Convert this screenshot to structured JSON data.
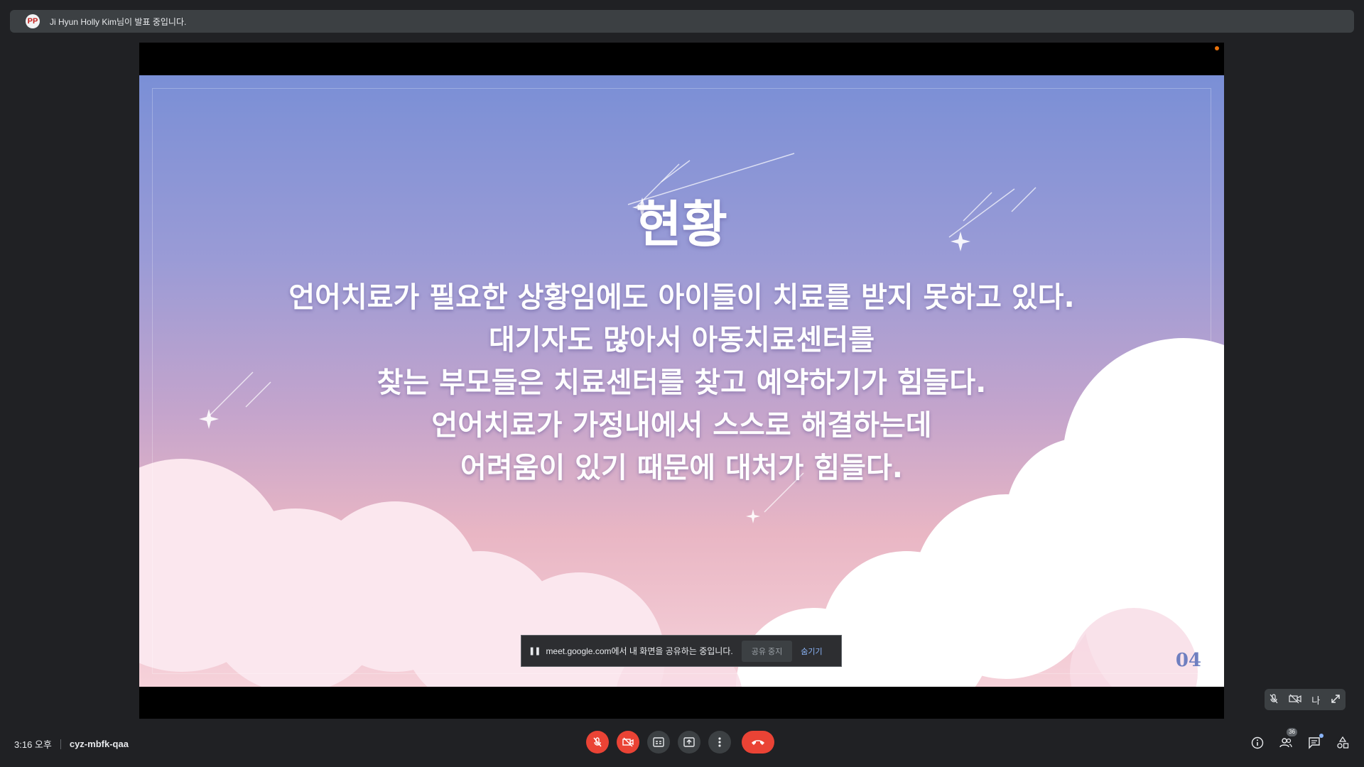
{
  "presenter_bar": {
    "avatar_text": "PP",
    "text": "Ji Hyun Holly Kim님이 발표 중입니다."
  },
  "slide": {
    "title": "현황",
    "body_lines": [
      "언어치료가 필요한 상황임에도 아이들이 치료를 받지 못하고 있다.",
      "대기자도 많아서 아동치료센터를",
      "찾는 부모들은 치료센터를 찾고 예약하기가 힘들다.",
      "언어치료가 가정내에서 스스로 해결하는데",
      "어려움이 있기 때문에 대처가 힘들다."
    ],
    "page_number": "04"
  },
  "share_banner": {
    "pause_glyph": "❚❚",
    "text": "meet.google.com에서 내 화면을 공유하는 중입니다.",
    "stop_label": "공유 중지",
    "hide_label": "숨기기"
  },
  "self_tile": {
    "name": "나"
  },
  "bottom_bar": {
    "time": "3:16 오후",
    "meeting_code": "cyz-mbfk-qaa",
    "participants_count": "36"
  },
  "colors": {
    "end_call": "#ea4335",
    "accent": "#8ab4f8",
    "background": "#202124"
  },
  "icons": [
    "mic-off-icon",
    "camera-off-icon",
    "captions-icon",
    "present-icon",
    "more-options-icon",
    "end-call-icon",
    "info-icon",
    "people-icon",
    "chat-icon",
    "activities-icon"
  ]
}
